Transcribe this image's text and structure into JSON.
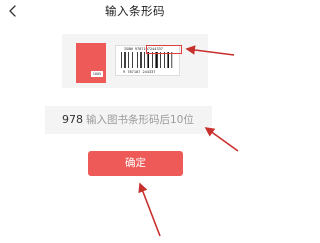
{
  "header": {
    "title": "输入条形码"
  },
  "illustration": {
    "isbn_text": "ISBN 9787107244337",
    "barcode_digits": "9 787107 244337",
    "book_tag": "1005",
    "highlight_color": "#e0403d"
  },
  "input": {
    "prefix": "978",
    "placeholder": "输入图书条形码后10位",
    "value": ""
  },
  "confirm": {
    "label": "确定"
  },
  "colors": {
    "accent": "#ee5a57",
    "field_bg": "#f4f4f4",
    "arrow": "#c8302d"
  }
}
